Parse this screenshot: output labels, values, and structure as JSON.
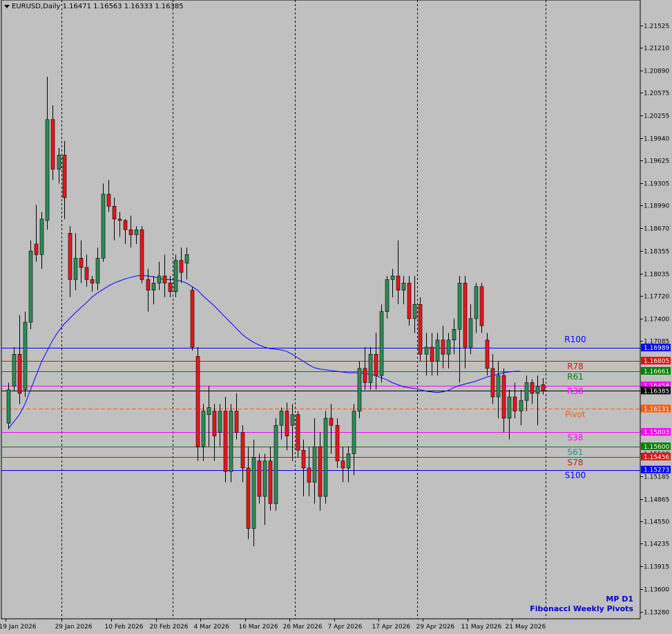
{
  "header": {
    "symbol": "EURUSD,Daily",
    "open": "1.16471",
    "high": "1.16563",
    "low": "1.16333",
    "close": "1.16385"
  },
  "brand": {
    "line1": "MP D1",
    "line2": "Fibonacci Weekly Pivots"
  },
  "colors": {
    "background": "#c0c0c0",
    "bull_body": "#2e8b57",
    "bear_body": "#e8151f",
    "wick": "#000000",
    "ma_line": "#0000ff",
    "grid": "#000000"
  },
  "chart_data": {
    "type": "candlestick",
    "ylim": [
      1.1318,
      1.2188
    ],
    "y_ticks": [
      "1.21525",
      "1.21210",
      "1.20890",
      "1.20575",
      "1.20255",
      "1.19940",
      "1.19625",
      "1.19305",
      "1.18990",
      "1.18670",
      "1.18355",
      "1.18035",
      "1.17720",
      "1.17400",
      "1.17085",
      "1.16450",
      "1.16130",
      "1.15815",
      "1.15500",
      "1.15185",
      "1.14865",
      "1.14550",
      "1.14235",
      "1.13915",
      "1.13600",
      "1.13280"
    ],
    "x_labels": [
      {
        "label": "19 Jan 2026",
        "bar": 0
      },
      {
        "label": "29 Jan 2026",
        "bar": 10
      },
      {
        "label": "10 Feb 2026",
        "bar": 19
      },
      {
        "label": "20 Feb 2026",
        "bar": 27
      },
      {
        "label": "4 Mar 2026",
        "bar": 35
      },
      {
        "label": "16 Mar 2026",
        "bar": 43
      },
      {
        "label": "26 Mar 2026",
        "bar": 51
      },
      {
        "label": "7 Apr 2026",
        "bar": 59
      },
      {
        "label": "17 Apr 2026",
        "bar": 67
      },
      {
        "label": "29 Apr 2026",
        "bar": 75
      },
      {
        "label": "11 May 2026",
        "bar": 83
      },
      {
        "label": "21 May 2026",
        "bar": 91
      }
    ],
    "vgrid_bars": [
      10,
      30,
      52,
      74,
      97
    ],
    "pivots": [
      {
        "name": "R100",
        "price": 1.16989,
        "value_label": "1.16989",
        "color": "#0000ff",
        "label_color": "#0000ff",
        "style": "solid"
      },
      {
        "name": "R78",
        "price": 1.16805,
        "value_label": "1.16805",
        "color": "#e01010",
        "label_color": "#e01010",
        "style": "solid"
      },
      {
        "name": "R61",
        "price": 1.16661,
        "value_label": "1.16661",
        "color": "#008000",
        "label_color": "#008000",
        "style": "solid"
      },
      {
        "name": "R38",
        "price": 1.16458,
        "value_label": "1.16458",
        "color": "#ff00ff",
        "label_color": "#ff00ff",
        "style": "solid"
      },
      {
        "name": "Pivot",
        "price": 1.16131,
        "value_label": "1.16131",
        "color": "#ff5a10",
        "label_color": "#ff5a10",
        "style": "dash"
      },
      {
        "name": "S38",
        "price": 1.15803,
        "value_label": "1.15803",
        "color": "#ff00ff",
        "label_color": "#ff00ff",
        "style": "solid"
      },
      {
        "name": "S61",
        "price": 1.156,
        "value_label": "1.15600",
        "color": "#008000",
        "label_color": "#2e8b8b",
        "style": "solid"
      },
      {
        "name": "S78",
        "price": 1.15456,
        "value_label": "1.15456",
        "color": "#e01010",
        "label_color": "#e01010",
        "style": "solid"
      },
      {
        "name": "S100",
        "price": 1.15273,
        "value_label": "1.15273",
        "color": "#0000ff",
        "label_color": "#0000ff",
        "style": "solid"
      }
    ],
    "current_price": {
      "price": 1.16385,
      "value_label": "1.16385"
    },
    "candles": [
      [
        1.1593,
        1.165,
        1.1585,
        1.164
      ],
      [
        1.1645,
        1.17,
        1.1638,
        1.169
      ],
      [
        1.169,
        1.1745,
        1.162,
        1.1635
      ],
      [
        1.164,
        1.175,
        1.163,
        1.1735
      ],
      [
        1.1735,
        1.185,
        1.1725,
        1.1835
      ],
      [
        1.1845,
        1.19,
        1.182,
        1.183
      ],
      [
        1.183,
        1.189,
        1.181,
        1.188
      ],
      [
        1.1878,
        1.208,
        1.1865,
        1.202
      ],
      [
        1.202,
        1.204,
        1.1935,
        1.195
      ],
      [
        1.195,
        1.198,
        1.193,
        1.197
      ],
      [
        1.197,
        1.199,
        1.188,
        1.191
      ],
      [
        1.186,
        1.187,
        1.177,
        1.1795
      ],
      [
        1.1795,
        1.186,
        1.178,
        1.1825
      ],
      [
        1.1825,
        1.185,
        1.179,
        1.1812
      ],
      [
        1.1812,
        1.183,
        1.1785,
        1.1795
      ],
      [
        1.1795,
        1.18,
        1.1778,
        1.179
      ],
      [
        1.179,
        1.184,
        1.178,
        1.1825
      ],
      [
        1.1825,
        1.193,
        1.182,
        1.1915
      ],
      [
        1.1915,
        1.1935,
        1.189,
        1.1898
      ],
      [
        1.1898,
        1.191,
        1.185,
        1.188
      ],
      [
        1.188,
        1.189,
        1.1855,
        1.1878
      ],
      [
        1.1878,
        1.188,
        1.1845,
        1.1865
      ],
      [
        1.1865,
        1.1885,
        1.184,
        1.1858
      ],
      [
        1.1858,
        1.187,
        1.1845,
        1.1865
      ],
      [
        1.1865,
        1.187,
        1.179,
        1.1795
      ],
      [
        1.1795,
        1.181,
        1.175,
        1.178
      ],
      [
        1.178,
        1.18,
        1.176,
        1.179
      ],
      [
        1.179,
        1.182,
        1.178,
        1.18
      ],
      [
        1.18,
        1.183,
        1.177,
        1.179
      ],
      [
        1.179,
        1.18,
        1.177,
        1.1778
      ],
      [
        1.1778,
        1.183,
        1.177,
        1.1822
      ],
      [
        1.1822,
        1.184,
        1.179,
        1.1805
      ],
      [
        1.1818,
        1.184,
        1.1795,
        1.183
      ],
      [
        1.178,
        1.1785,
        1.1695,
        1.17
      ],
      [
        1.1687,
        1.17,
        1.154,
        1.156
      ],
      [
        1.156,
        1.162,
        1.154,
        1.161
      ],
      [
        1.1605,
        1.1645,
        1.156,
        1.1615
      ],
      [
        1.161,
        1.162,
        1.154,
        1.1575
      ],
      [
        1.158,
        1.162,
        1.156,
        1.161
      ],
      [
        1.161,
        1.163,
        1.151,
        1.1525
      ],
      [
        1.1525,
        1.162,
        1.151,
        1.161
      ],
      [
        1.161,
        1.1635,
        1.157,
        1.158
      ],
      [
        1.158,
        1.159,
        1.151,
        1.153
      ],
      [
        1.153,
        1.156,
        1.143,
        1.1445
      ],
      [
        1.1445,
        1.157,
        1.142,
        1.1545
      ],
      [
        1.154,
        1.155,
        1.148,
        1.149
      ],
      [
        1.149,
        1.155,
        1.145,
        1.154
      ],
      [
        1.154,
        1.156,
        1.147,
        1.148
      ],
      [
        1.148,
        1.16,
        1.147,
        1.159
      ],
      [
        1.159,
        1.1615,
        1.157,
        1.161
      ],
      [
        1.161,
        1.1622,
        1.1555,
        1.1575
      ],
      [
        1.159,
        1.162,
        1.154,
        1.1605
      ],
      [
        1.1605,
        1.161,
        1.1545,
        1.1555
      ],
      [
        1.1555,
        1.157,
        1.149,
        1.153
      ],
      [
        1.153,
        1.156,
        1.149,
        1.151
      ],
      [
        1.151,
        1.16,
        1.148,
        1.156
      ],
      [
        1.156,
        1.158,
        1.147,
        1.149
      ],
      [
        1.149,
        1.161,
        1.148,
        1.16
      ],
      [
        1.16,
        1.162,
        1.155,
        1.159
      ],
      [
        1.159,
        1.16,
        1.153,
        1.154
      ],
      [
        1.154,
        1.156,
        1.151,
        1.153
      ],
      [
        1.153,
        1.156,
        1.151,
        1.155
      ],
      [
        1.155,
        1.162,
        1.152,
        1.161
      ],
      [
        1.161,
        1.168,
        1.16,
        1.167
      ],
      [
        1.167,
        1.17,
        1.164,
        1.165
      ],
      [
        1.165,
        1.17,
        1.164,
        1.169
      ],
      [
        1.169,
        1.172,
        1.164,
        1.166
      ],
      [
        1.166,
        1.176,
        1.165,
        1.175
      ],
      [
        1.175,
        1.18,
        1.174,
        1.1795
      ],
      [
        1.1795,
        1.181,
        1.177,
        1.18
      ],
      [
        1.18,
        1.185,
        1.176,
        1.178
      ],
      [
        1.178,
        1.18,
        1.176,
        1.179
      ],
      [
        1.179,
        1.18,
        1.173,
        1.174
      ],
      [
        1.174,
        1.18,
        1.172,
        1.176
      ],
      [
        1.176,
        1.177,
        1.168,
        1.169
      ],
      [
        1.169,
        1.172,
        1.166,
        1.17
      ],
      [
        1.17,
        1.172,
        1.166,
        1.168
      ],
      [
        1.168,
        1.172,
        1.166,
        1.171
      ],
      [
        1.171,
        1.173,
        1.167,
        1.169
      ],
      [
        1.169,
        1.172,
        1.167,
        1.171
      ],
      [
        1.171,
        1.174,
        1.169,
        1.1725
      ],
      [
        1.1725,
        1.18,
        1.165,
        1.179
      ],
      [
        1.179,
        1.18,
        1.167,
        1.17
      ],
      [
        1.17,
        1.176,
        1.169,
        1.174
      ],
      [
        1.174,
        1.179,
        1.172,
        1.1785
      ],
      [
        1.1785,
        1.179,
        1.172,
        1.173
      ],
      [
        1.171,
        1.172,
        1.166,
        1.167
      ],
      [
        1.167,
        1.169,
        1.162,
        1.163
      ],
      [
        1.163,
        1.168,
        1.16,
        1.166
      ],
      [
        1.166,
        1.167,
        1.158,
        1.16
      ],
      [
        1.16,
        1.164,
        1.157,
        1.163
      ],
      [
        1.163,
        1.165,
        1.16,
        1.161
      ],
      [
        1.161,
        1.164,
        1.159,
        1.1625
      ],
      [
        1.1625,
        1.166,
        1.161,
        1.165
      ],
      [
        1.165,
        1.1655,
        1.162,
        1.1635
      ],
      [
        1.1635,
        1.166,
        1.159,
        1.1645
      ],
      [
        1.16471,
        1.16563,
        1.16333,
        1.16385
      ]
    ],
    "ma": [
      [
        1.1585
      ],
      [
        1.1595
      ],
      [
        1.1605
      ],
      [
        1.162
      ],
      [
        1.164
      ],
      [
        1.166
      ],
      [
        1.168
      ],
      [
        1.1695
      ],
      [
        1.171
      ],
      [
        1.1722
      ],
      [
        1.1732
      ],
      [
        1.174
      ],
      [
        1.1748
      ],
      [
        1.1755
      ],
      [
        1.1762
      ],
      [
        1.177
      ],
      [
        1.1776
      ],
      [
        1.1781
      ],
      [
        1.1786
      ],
      [
        1.179
      ],
      [
        1.1793
      ],
      [
        1.1796
      ],
      [
        1.1798
      ],
      [
        1.18
      ],
      [
        1.1801
      ],
      [
        1.18
      ],
      [
        1.1799
      ],
      [
        1.1797
      ],
      [
        1.1795
      ],
      [
        1.1795
      ],
      [
        1.1794
      ],
      [
        1.1793
      ],
      [
        1.179
      ],
      [
        1.1785
      ],
      [
        1.178
      ],
      [
        1.1772
      ],
      [
        1.1765
      ],
      [
        1.1758
      ],
      [
        1.175
      ],
      [
        1.1742
      ],
      [
        1.1734
      ],
      [
        1.1726
      ],
      [
        1.1718
      ],
      [
        1.1712
      ],
      [
        1.1707
      ],
      [
        1.1703
      ],
      [
        1.17
      ],
      [
        1.1698
      ],
      [
        1.1697
      ],
      [
        1.1696
      ],
      [
        1.1694
      ],
      [
        1.169
      ],
      [
        1.1685
      ],
      [
        1.168
      ],
      [
        1.1675
      ],
      [
        1.1671
      ],
      [
        1.1669
      ],
      [
        1.1668
      ],
      [
        1.1667
      ],
      [
        1.1666
      ],
      [
        1.1665
      ],
      [
        1.1664
      ],
      [
        1.1664
      ],
      [
        1.1664
      ],
      [
        1.1663
      ],
      [
        1.1662
      ],
      [
        1.166
      ],
      [
        1.1657
      ],
      [
        1.1654
      ],
      [
        1.165
      ],
      [
        1.1647
      ],
      [
        1.1644
      ],
      [
        1.1643
      ],
      [
        1.1642
      ],
      [
        1.164
      ],
      [
        1.1638
      ],
      [
        1.1637
      ],
      [
        1.1636
      ],
      [
        1.1637
      ],
      [
        1.1639
      ],
      [
        1.1643
      ],
      [
        1.1646
      ],
      [
        1.1648
      ],
      [
        1.165
      ],
      [
        1.1652
      ],
      [
        1.1655
      ],
      [
        1.1658
      ],
      [
        1.166
      ],
      [
        1.1662
      ],
      [
        1.1664
      ],
      [
        1.1665
      ],
      [
        1.1666
      ],
      [
        1.1666
      ]
    ]
  }
}
